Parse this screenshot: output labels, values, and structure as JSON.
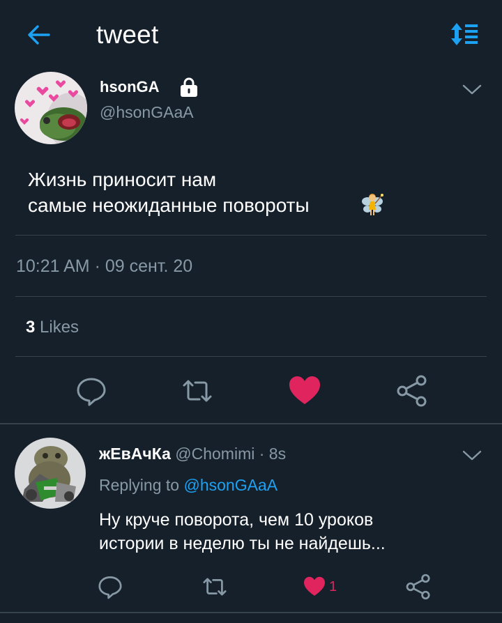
{
  "header": {
    "title": "tweet",
    "back_icon": "back-arrow-icon",
    "sort_icon": "sort-icon",
    "accent": "#1da1f2"
  },
  "main_tweet": {
    "display_name": "hsonGA",
    "handle": "@hsonGAaA",
    "text": "Жизнь приносит нам\nсамые неожиданные повороты",
    "emoji": "fairy-icon",
    "timestamp": "10:21 AM · 09 сент. 20",
    "likes_count": "3",
    "likes_label": "Likes",
    "liked": true,
    "like_color": "#e0245e"
  },
  "reply_tweet": {
    "display_name": "жЕвАчКа",
    "handle": "@Chomimi",
    "age": "· 8s",
    "replying_prefix": "Replying to",
    "replying_to": "@hsonGAaA",
    "text": "Ну круче поворота, чем 10 уроков\nистории в неделю ты не найдешь...",
    "like_count": "1",
    "liked": true
  },
  "colors": {
    "background": "#15202b",
    "divider": "#38444d",
    "secondary_text": "#8899a6"
  }
}
